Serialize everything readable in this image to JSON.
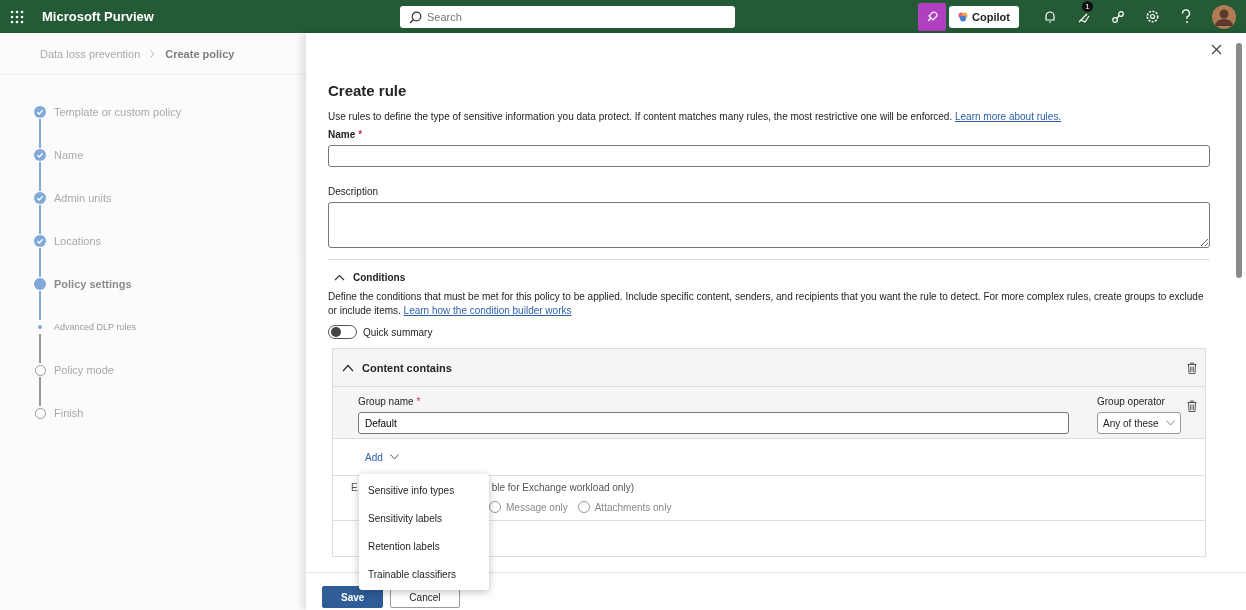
{
  "topbar": {
    "app_name": "Microsoft Purview",
    "search": {
      "placeholder": "Search"
    },
    "copilot_label": "Copilot",
    "notification_badge": "1"
  },
  "breadcrumb": [
    {
      "label": "Data loss prevention",
      "current": false
    },
    {
      "label": "Create policy",
      "current": true
    }
  ],
  "steps": [
    {
      "label": "Template or custom policy",
      "kind": "step",
      "completed": true,
      "current": false
    },
    {
      "label": "Name",
      "kind": "step",
      "completed": true,
      "current": false
    },
    {
      "label": "Admin units",
      "kind": "step",
      "completed": true,
      "current": false
    },
    {
      "label": "Locations",
      "kind": "step",
      "completed": true,
      "current": false
    },
    {
      "label": "Policy settings",
      "kind": "step",
      "completed": false,
      "current": true
    },
    {
      "label": "Advanced DLP rules",
      "kind": "substep",
      "completed": false,
      "current": true
    },
    {
      "label": "Policy mode",
      "kind": "step",
      "completed": false,
      "current": false
    },
    {
      "label": "Finish",
      "kind": "step",
      "completed": false,
      "current": false
    }
  ],
  "panel": {
    "title": "Create rule",
    "intro": "Use rules to define the type of sensitive information you data protect. If content matches many rules, the most restrictive one will be enforced.",
    "intro_link": "Learn more about rules.",
    "name_field": {
      "label": "Name",
      "required_mark": "*"
    },
    "description_field": {
      "label": "Description"
    },
    "conditions": {
      "title": "Conditions",
      "expanded": true,
      "text": "Define the conditions that must be met for this policy to be applied. Include specific content, senders, and recipients that you want the rule to detect. For more complex rules, create groups to exclude or include items.",
      "link": "Learn how the condition builder works",
      "quick_summary": {
        "label": "Quick summary",
        "on": false
      },
      "group": {
        "title": "Content contains",
        "expanded": true,
        "name_label": "Group name",
        "name_required_mark": "*",
        "name_value": "Default",
        "operator_label": "Group operator",
        "operator_value": "Any of these",
        "add_label": "Add",
        "apply_label_start": "E",
        "apply_label_end": "ble for Exchange workload only)",
        "apply_options": [
          {
            "label": "Message only",
            "selected": false
          },
          {
            "label": "Attachments only",
            "selected": false
          }
        ]
      }
    },
    "add_menu": [
      {
        "label": "Sensitive info types"
      },
      {
        "label": "Sensitivity labels"
      },
      {
        "label": "Retention labels"
      },
      {
        "label": "Trainable classifiers"
      }
    ],
    "buttons": [
      {
        "label": "Save",
        "kind": "primary"
      },
      {
        "label": "Cancel",
        "kind": "secondary"
      }
    ]
  }
}
